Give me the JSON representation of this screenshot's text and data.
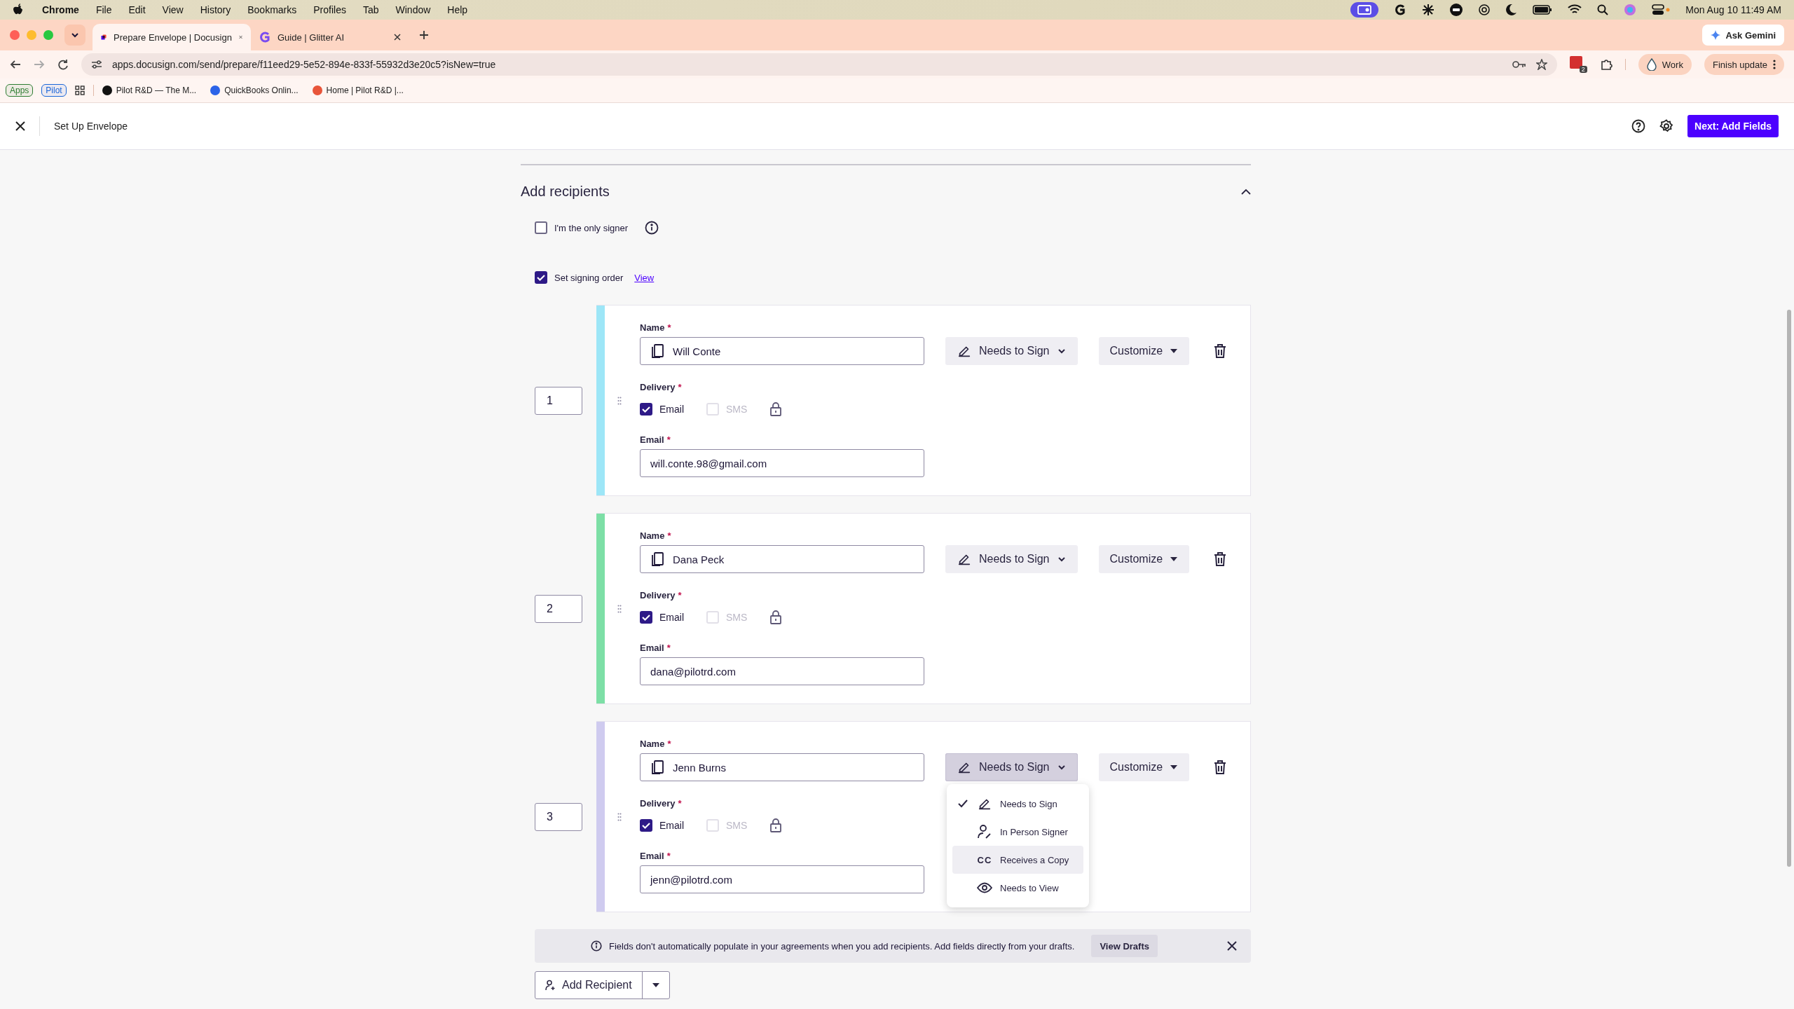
{
  "menu_bar": {
    "app": "Chrome",
    "items": [
      "File",
      "Edit",
      "View",
      "History",
      "Bookmarks",
      "Profiles",
      "Tab",
      "Window",
      "Help"
    ],
    "clock": "Mon Aug 10  11:49 AM"
  },
  "browser": {
    "tabs": [
      {
        "title": "Prepare Envelope | Docusign",
        "selected": true
      },
      {
        "title": "Guide | Glitter AI",
        "selected": false
      }
    ],
    "ask_gemini": "Ask Gemini",
    "url": "apps.docusign.com/send/prepare/f11eed29-5e52-894e-833f-55932d3e20c5?isNew=true",
    "extension_badge": "2",
    "profile": "Work",
    "update": "Finish update",
    "bookmarks": [
      {
        "label": "Apps",
        "kind": "chip",
        "color": "#2e7d32"
      },
      {
        "label": "Pilot",
        "kind": "chip",
        "color": "#1a66d9"
      },
      {
        "label": "Pilot R&D — The M...",
        "kind": "link",
        "color": "#111111"
      },
      {
        "label": "QuickBooks Onlin...",
        "kind": "link",
        "color": "#2b63e8"
      },
      {
        "label": "Home | Pilot R&D |...",
        "kind": "link",
        "color": "#e8553a"
      }
    ]
  },
  "header": {
    "title": "Set Up Envelope",
    "next_button": "Next: Add Fields"
  },
  "section": {
    "title": "Add recipients",
    "expanded": true,
    "only_signer": {
      "label": "I'm the only signer",
      "checked": false
    },
    "signing_order": {
      "label": "Set signing order",
      "checked": true,
      "link": "View"
    }
  },
  "recipients": [
    {
      "order": "1",
      "color": "#9de6f7",
      "name_label": "Name",
      "name_required": "*",
      "name": "Will Conte",
      "role": "Needs to Sign",
      "menu_open": false,
      "customize": "Customize",
      "delivery_label": "Delivery",
      "delivery_required": "*",
      "delivery": [
        {
          "label": "Email",
          "checked": true,
          "disabled": false
        },
        {
          "label": "SMS",
          "checked": false,
          "disabled": true
        }
      ],
      "email_label": "Email",
      "email_required": "*",
      "email": "will.conte.98@gmail.com"
    },
    {
      "order": "2",
      "color": "#7ddfa6",
      "name_label": "Name",
      "name_required": "*",
      "name": "Dana Peck",
      "role": "Needs to Sign",
      "menu_open": false,
      "customize": "Customize",
      "delivery_label": "Delivery",
      "delivery_required": "*",
      "delivery": [
        {
          "label": "Email",
          "checked": true,
          "disabled": false
        },
        {
          "label": "SMS",
          "checked": false,
          "disabled": true
        }
      ],
      "email_label": "Email",
      "email_required": "*",
      "email": "dana@pilotrd.com"
    },
    {
      "order": "3",
      "color": "#cfcbef",
      "name_label": "Name",
      "name_required": "*",
      "name": "Jenn Burns",
      "role": "Needs to Sign",
      "menu_open": true,
      "customize": "Customize",
      "delivery_label": "Delivery",
      "delivery_required": "*",
      "delivery": [
        {
          "label": "Email",
          "checked": true,
          "disabled": false
        },
        {
          "label": "SMS",
          "checked": false,
          "disabled": true
        }
      ],
      "email_label": "Email",
      "email_required": "*",
      "email": "jenn@pilotrd.com"
    }
  ],
  "role_menu": {
    "items": [
      {
        "label": "Needs to Sign",
        "kind": "sign",
        "selected": true,
        "hovered": false
      },
      {
        "label": "In Person Signer",
        "kind": "person",
        "selected": false,
        "hovered": false
      },
      {
        "label": "Receives a Copy",
        "kind": "copy",
        "icon_text": "CC",
        "selected": false,
        "hovered": true
      },
      {
        "label": "Needs to View",
        "kind": "view",
        "selected": false,
        "hovered": false
      }
    ]
  },
  "notice": {
    "text": "Fields don't automatically populate in your agreements when you add recipients. Add fields directly from your drafts.",
    "button": "View Drafts"
  },
  "add_recipient": "Add Recipient"
}
